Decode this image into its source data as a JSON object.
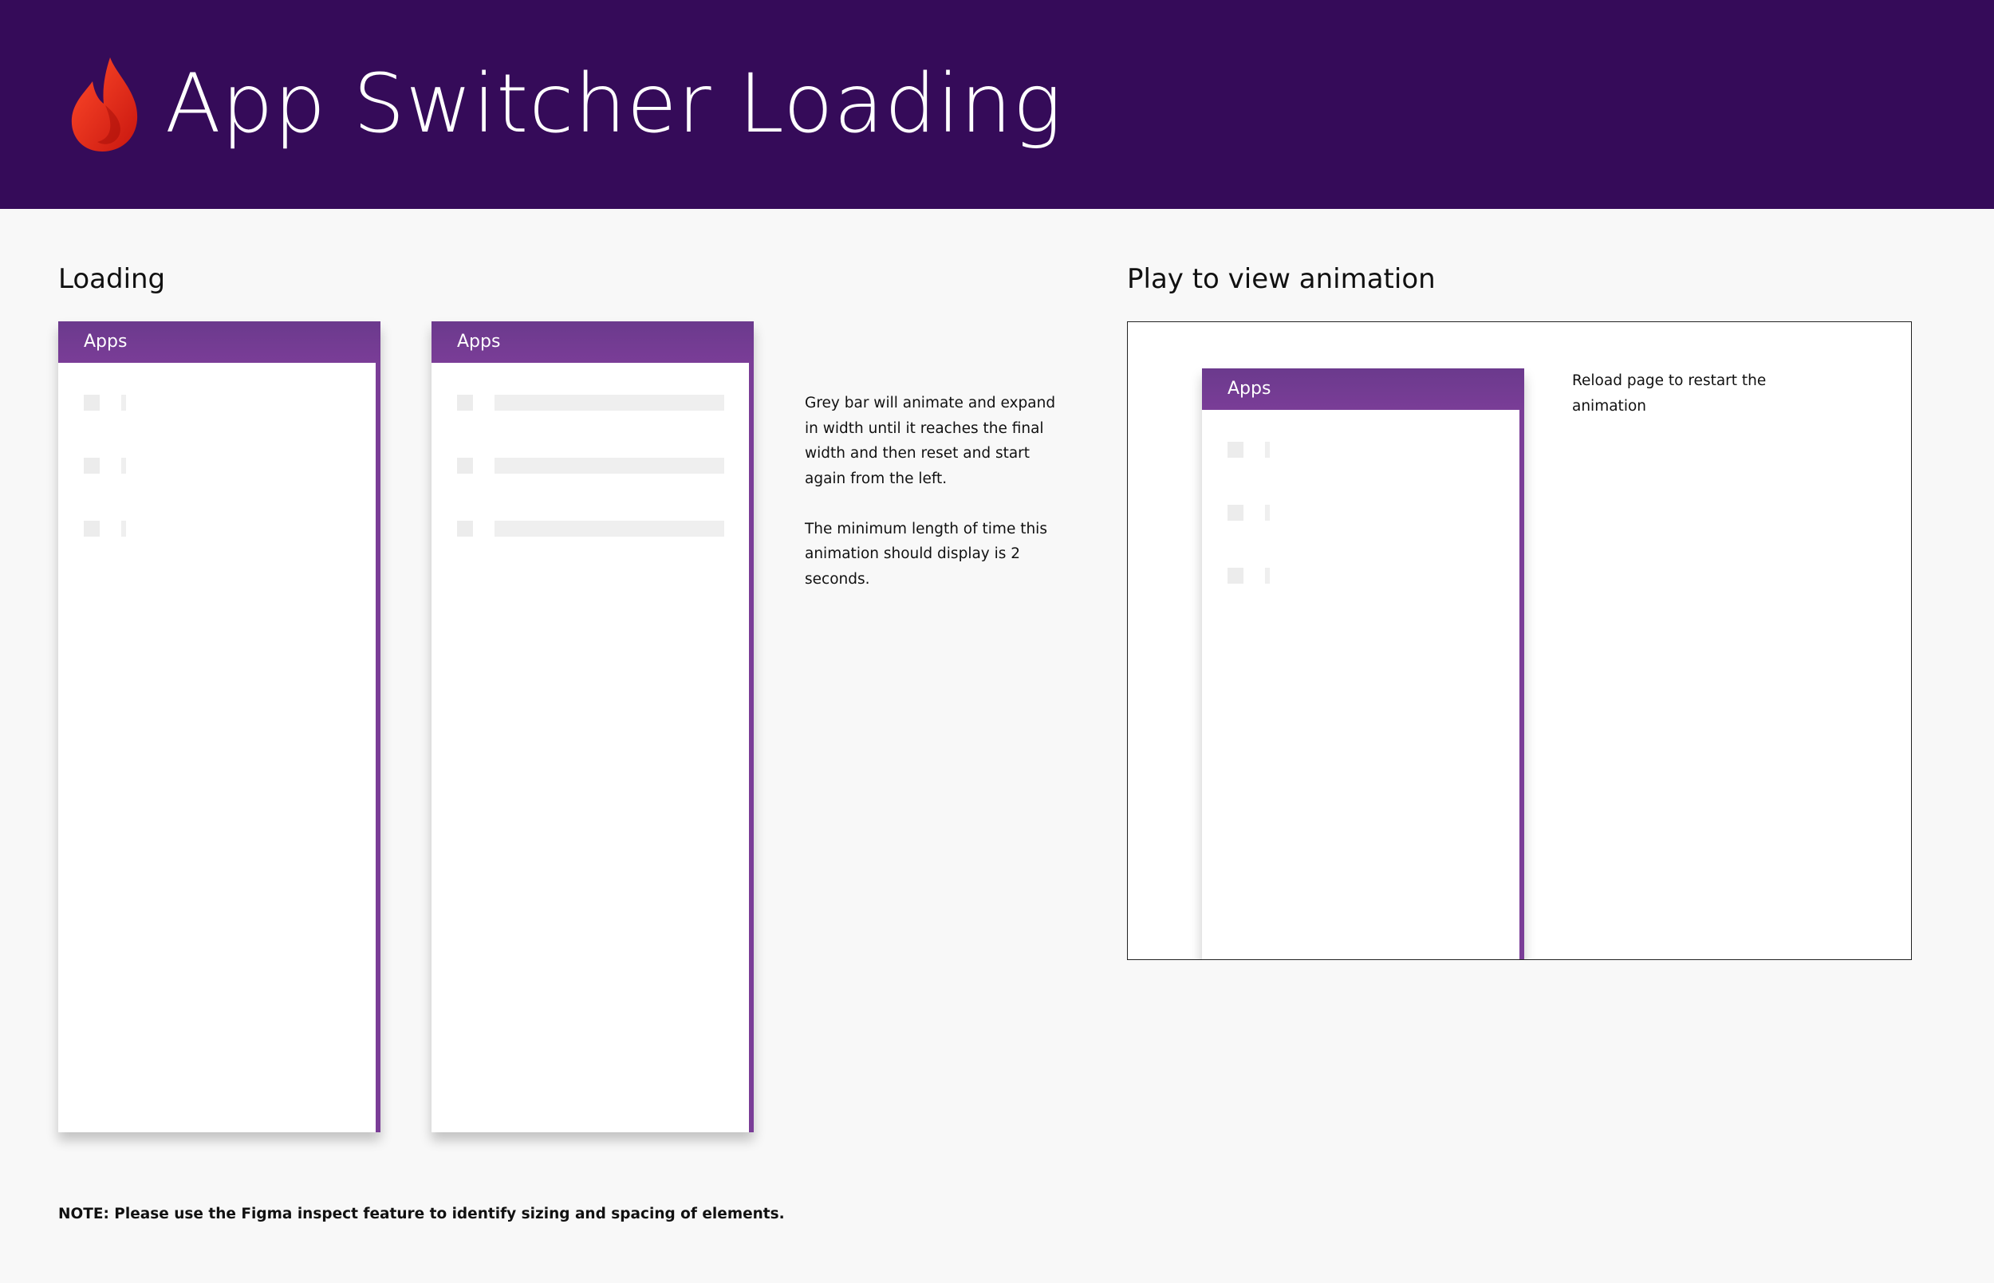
{
  "header": {
    "title": "App Switcher Loading",
    "logo_icon": "flame-icon",
    "background": "#350b59",
    "logo_color": "#e8231b"
  },
  "loading_section": {
    "heading": "Loading",
    "panels": [
      {
        "label": "Apps",
        "state": "start",
        "rows": 3
      },
      {
        "label": "Apps",
        "state": "final",
        "rows": 3
      }
    ]
  },
  "description": {
    "paragraph_1": [
      "Grey bar will animate and expand",
      "in width until it reaches the final",
      "width and then reset and start",
      "again from the left."
    ],
    "paragraph_2": [
      "The minimum length of time this",
      "animation should display is 2",
      "seconds."
    ]
  },
  "animation_section": {
    "heading": "Play to view animation",
    "panel_label": "Apps",
    "reload_note": [
      "Reload page to restart the",
      "animation"
    ]
  },
  "footer": {
    "note": "NOTE: Please use the Figma inspect feature to identify sizing and spacing of elements."
  },
  "colors": {
    "accent": "#7a3d97",
    "skeleton": "#efefef",
    "page_background": "#f8f8f8"
  }
}
